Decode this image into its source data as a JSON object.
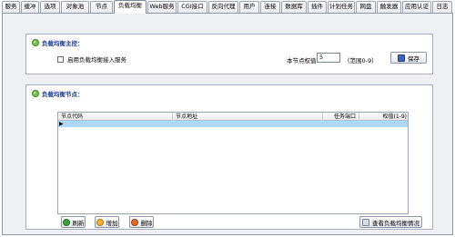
{
  "tabs": [
    "服务",
    "缓冲",
    "选项",
    "对象池",
    "节点",
    "负载均衡",
    "Web服务",
    "CGI接口",
    "反向代理",
    "用户",
    "连接",
    "数据库",
    "插件",
    "计划任务",
    "网盘",
    "触发器",
    "应用认证",
    "日志"
  ],
  "active_tab_index": 5,
  "lb_control": {
    "title": "负载均衡主控：",
    "enable_label": "启用负载均衡接入服务",
    "enable_checked": false,
    "weight_label": "本节点权值",
    "weight_value": "5",
    "range_hint": "（范围0-9）",
    "save_label": "保存"
  },
  "lb_nodes": {
    "title": "负载均衡节点：",
    "columns": [
      "节点代码",
      "节点地址",
      "任务端口",
      "权值(1-9)"
    ],
    "rows": [
      {
        "code": "",
        "address": "",
        "port": "",
        "weight": ""
      }
    ],
    "current_row_marker": "▶",
    "refresh_label": "刷新",
    "add_label": "增加",
    "delete_label": "删除",
    "view_label": "查看负载均衡情况"
  }
}
